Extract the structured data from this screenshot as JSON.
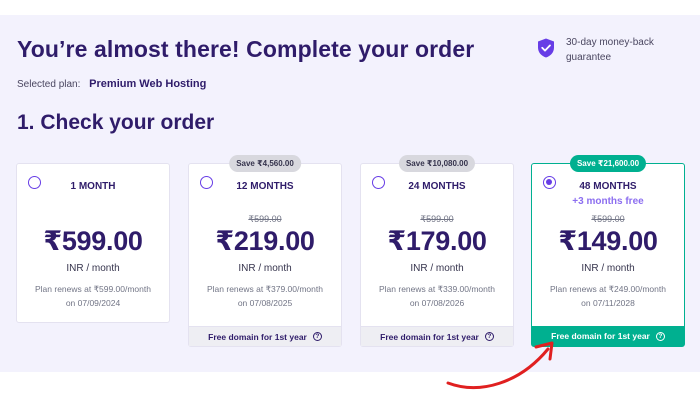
{
  "header": {
    "title": "You’re almost there! Complete your order",
    "guarantee": "30-day money-back guarantee"
  },
  "selected_plan": {
    "label": "Selected plan:",
    "name": "Premium Web Hosting"
  },
  "section_title": "1. Check your order",
  "colors": {
    "accent": "#673de6",
    "brand_dark": "#2f1c6a",
    "success": "#00b090",
    "arrow": "#e02020"
  },
  "plans": [
    {
      "duration": "1 MONTH",
      "price": "₹599.00",
      "per": "INR / month",
      "renews": "Plan renews at ₹599.00/month",
      "renews_date": "on 07/09/2024",
      "selected": false
    },
    {
      "duration": "12 MONTHS",
      "badge": "Save ₹4,560.00",
      "old_price": "₹599.00",
      "price": "₹219.00",
      "per": "INR / month",
      "renews": "Plan renews at ₹379.00/month",
      "renews_date": "on 07/08/2025",
      "footer": "Free domain for 1st year",
      "selected": false
    },
    {
      "duration": "24 MONTHS",
      "badge": "Save ₹10,080.00",
      "old_price": "₹599.00",
      "price": "₹179.00",
      "per": "INR / month",
      "renews": "Plan renews at ₹339.00/month",
      "renews_date": "on 07/08/2026",
      "footer": "Free domain for 1st year",
      "selected": false
    },
    {
      "duration": "48 MONTHS",
      "bonus": "+3 months free",
      "badge": "Save ₹21,600.00",
      "old_price": "₹599.00",
      "price": "₹149.00",
      "per": "INR / month",
      "renews": "Plan renews at ₹249.00/month",
      "renews_date": "on 07/11/2028",
      "footer": "Free domain for 1st year",
      "selected": true
    }
  ],
  "icons": {
    "guarantee": "shield-check-icon",
    "help": "question-circle-icon",
    "arrow": "curved-arrow-annotation"
  }
}
